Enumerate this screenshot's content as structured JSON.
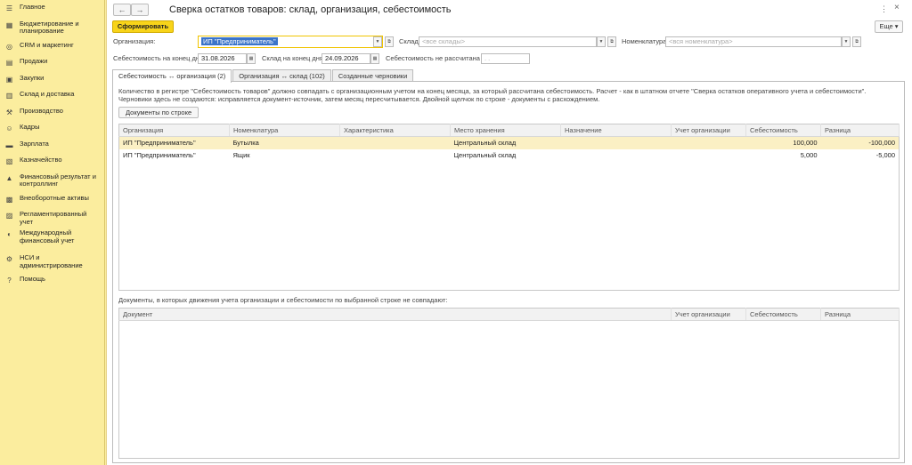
{
  "sidebar": {
    "items": [
      {
        "label": "Главное",
        "icon": "menu-icon"
      },
      {
        "label": "Бюджетирование и планирование",
        "icon": "budget-icon"
      },
      {
        "label": "CRM и маркетинг",
        "icon": "crm-icon"
      },
      {
        "label": "Продажи",
        "icon": "sales-icon"
      },
      {
        "label": "Закупки",
        "icon": "purchases-icon"
      },
      {
        "label": "Склад и доставка",
        "icon": "warehouse-icon"
      },
      {
        "label": "Производство",
        "icon": "production-icon"
      },
      {
        "label": "Кадры",
        "icon": "people-icon"
      },
      {
        "label": "Зарплата",
        "icon": "salary-icon"
      },
      {
        "label": "Казначейство",
        "icon": "treasury-icon"
      },
      {
        "label": "Финансовый результат и контроллинг",
        "icon": "finance-icon"
      },
      {
        "label": "Внеоборотные активы",
        "icon": "assets-icon"
      },
      {
        "label": "Регламентированный учет",
        "icon": "accounting-icon"
      },
      {
        "label": "Международный финансовый учет",
        "icon": "international-icon"
      },
      {
        "label": "НСИ и администрирование",
        "icon": "gear-icon"
      },
      {
        "label": "Помощь",
        "icon": "help-icon"
      }
    ]
  },
  "header": {
    "title": "Сверка остатков товаров: склад, организация, себестоимость",
    "back": "←",
    "forward": "→",
    "menu_dots": "⋮",
    "close": "×"
  },
  "toolbar": {
    "generate_label": "Сформировать",
    "more_label": "Еще ▾"
  },
  "filters": {
    "org_label": "Организация:",
    "org_value": "ИП \"Предприниматель\"",
    "warehouse_label": "Склад:",
    "warehouse_placeholder": "<все склады>",
    "nomenclature_label": "Номенклатура:",
    "nomenclature_placeholder": "<вся номенклатура>",
    "cost_end_label": "Себестоимость на конец дня:",
    "cost_end_value": "31.08.2026",
    "warehouse_end_label": "Склад на конец дня:",
    "warehouse_end_value": "24.09.2026",
    "cost_not_calc_label": "Себестоимость не рассчитана с:",
    "cost_not_calc_value": "  .  .    "
  },
  "tabs": [
    {
      "label": "Себестоимость ↔ организация (2)",
      "active": true
    },
    {
      "label": "Организация ↔ склад (102)",
      "active": false
    },
    {
      "label": "Созданные черновики",
      "active": false
    }
  ],
  "info_text": "Количество в регистре \"Себестоимость товаров\" должно совпадать с организационным учетом на конец месяца, за который рассчитана себестоимость. Расчет - как в штатном отчете \"Сверка остатков оперативного учета и себестоимости\". Черновики здесь не создаются: исправляется документ-источник, затем месяц пересчитывается. Двойной щелчок по строке - документы с расхождением.",
  "docs_button_label": "Документы по строке",
  "table1": {
    "headers": [
      "Организация",
      "Номенклатура",
      "Характеристика",
      "Место хранения",
      "Назначение",
      "Учет организации",
      "Себестоимость",
      "Разница"
    ],
    "rows": [
      [
        "ИП \"Предприниматель\"",
        "Бутылка",
        "",
        "Центральный склад",
        "",
        "",
        "100,000",
        "-100,000"
      ],
      [
        "ИП \"Предприниматель\"",
        "Ящик",
        "",
        "Центральный склад",
        "",
        "",
        "5,000",
        "-5,000"
      ]
    ]
  },
  "table2": {
    "caption": "Документы, в которых движения учета организации и себестоимости по выбранной строке не совпадают:",
    "headers": [
      "Документ",
      "Учет организации",
      "Себестоимость",
      "Разница"
    ]
  },
  "colors": {
    "sidebar_bg": "#fbed9e",
    "primary_button": "#f8d41a",
    "selected_row": "#fbf0c4",
    "selection": "#3b74c9"
  }
}
